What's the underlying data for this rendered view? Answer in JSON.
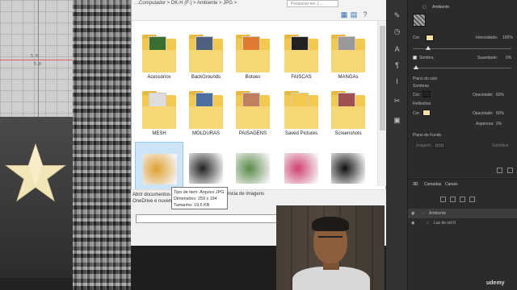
{
  "explorer": {
    "address_path": "...Computador  >  DK-H (F:)  >  Ambiente  >  JPG  >",
    "search_placeholder": "Pesquisar em J...",
    "items": [
      {
        "label": "Acessorios",
        "kind": "folder",
        "preview": "#3b6f30"
      },
      {
        "label": "BackGrounds",
        "kind": "folder",
        "preview": "#506080"
      },
      {
        "label": "Botoes",
        "kind": "folder",
        "preview": "#e07a30"
      },
      {
        "label": "FAISCAS",
        "kind": "folder",
        "preview": "#222222"
      },
      {
        "label": "MANGAs",
        "kind": "folder",
        "preview": "#999999"
      },
      {
        "label": "MESH",
        "kind": "folder",
        "preview": "#dddddd"
      },
      {
        "label": "MOLDURAS",
        "kind": "folder",
        "preview": "#4a6fa0"
      },
      {
        "label": "PAISAGENS",
        "kind": "folder",
        "preview": "#c08060"
      },
      {
        "label": "Saved Pictures",
        "kind": "folder",
        "preview": "#f2c94c"
      },
      {
        "label": "Screenshots",
        "kind": "folder",
        "preview": "#a05050"
      },
      {
        "label": "",
        "kind": "image",
        "preview": "#e0a030"
      },
      {
        "label": "",
        "kind": "image",
        "preview": "#222222"
      },
      {
        "label": "",
        "kind": "image",
        "preview": "#5a8a4a"
      },
      {
        "label": "",
        "kind": "image",
        "preview": "#d04070"
      },
      {
        "label": "",
        "kind": "image",
        "preview": "#111111"
      }
    ],
    "status_left": "Abrir documentos do OneDrive e nuvem",
    "status_right": "ência de imagens",
    "tooltip": {
      "line1": "Tipo de item: Arquivo JPG",
      "line2": "Dimensões: 259 x 194",
      "line3": "Tamanho: 19,6 KB"
    }
  },
  "viewport": {
    "label_a": "5.0",
    "label_b": "5.0"
  },
  "photoshop": {
    "panel_title": "Ambiente",
    "cor_label": "Cor:",
    "intensidade_label": "Intensidade:",
    "intensidade_value": "100%",
    "sombra_label": "Sombra",
    "suavidade_label": "Suavidade:",
    "suavidade_value": "0%",
    "plano_solo_label": "Plano do solo",
    "sombras_label": "Sombras",
    "opacidade1_label": "Opacidade:",
    "opacidade1_value": "60%",
    "reflexoes_label": "Reflexões",
    "opacidade2_label": "Opacidade:",
    "opacidade2_value": "60%",
    "aspereza_label": "Aspereza:",
    "aspereza_value": "0%",
    "plano_fundo_label": "Plano de Fundo",
    "imagem_label": "Imagem:",
    "substituir_label": "Substituir",
    "tabs": [
      "3D",
      "Camadas",
      "Canais"
    ],
    "layers": [
      "Ambiente",
      "Luz do sol 0"
    ],
    "colors": {
      "light_swatch": "#f5dfa0",
      "shadow_swatch": "#222222",
      "reflection_swatch": "#f5dfa0"
    }
  },
  "branding": "udemy"
}
